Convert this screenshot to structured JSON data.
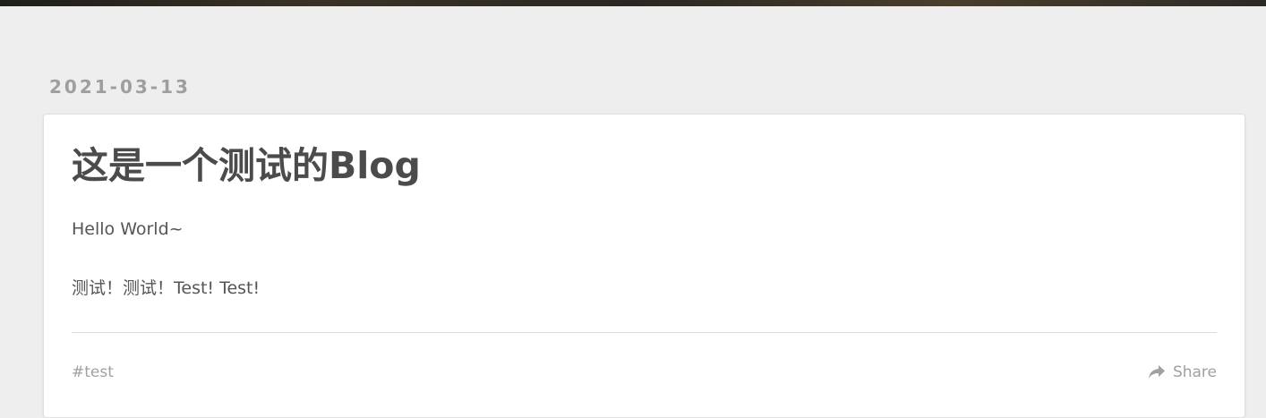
{
  "post": {
    "date": "2021-03-13",
    "title": "这是一个测试的Blog",
    "paragraphs": [
      "Hello World~",
      "测试！测试！Test! Test!"
    ],
    "tag": "#test",
    "share_label": "Share",
    "share_icon": "share-arrow-icon"
  },
  "colors": {
    "page_background": "#eeeeee",
    "card_background": "#ffffff",
    "title_text": "#4b4b4b",
    "muted_text": "#a0a0a0"
  }
}
